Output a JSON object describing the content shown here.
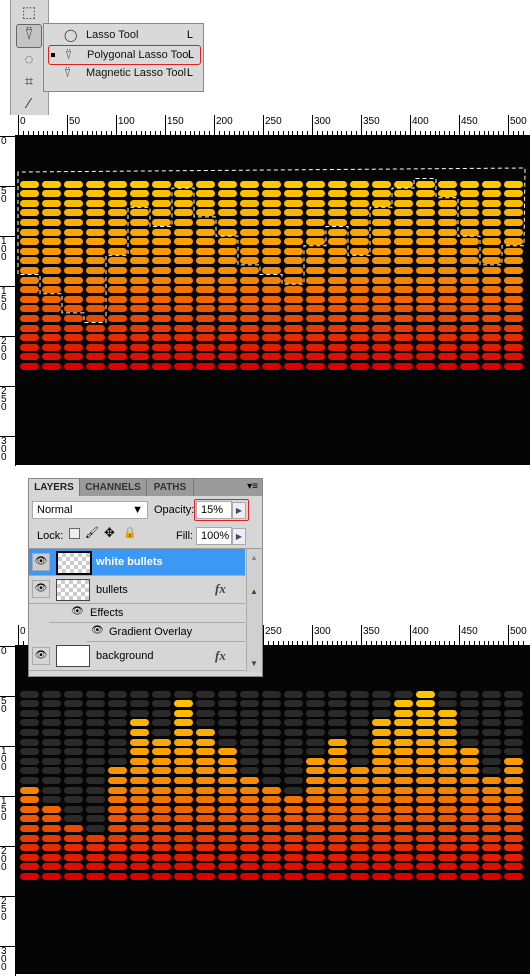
{
  "tools_flyout": {
    "items": [
      {
        "label": "Lasso Tool",
        "shortcut": "L",
        "icon": "lasso-icon"
      },
      {
        "label": "Polygonal Lasso Tool",
        "shortcut": "L",
        "icon": "polygonal-lasso-icon",
        "selected": true
      },
      {
        "label": "Magnetic Lasso Tool",
        "shortcut": "L",
        "icon": "magnetic-lasso-icon"
      }
    ]
  },
  "ruler": {
    "h_labels": [
      "0",
      "50",
      "100",
      "150",
      "200",
      "250",
      "300",
      "350",
      "400",
      "450",
      "500"
    ],
    "v_labels": [
      "0",
      "50",
      "100",
      "150",
      "200",
      "250",
      "300"
    ]
  },
  "meter": {
    "columns": 23,
    "rows": 20,
    "levels": [
      10,
      8,
      6,
      5,
      12,
      17,
      15,
      19,
      16,
      14,
      11,
      10,
      9,
      13,
      15,
      12,
      17,
      19,
      20,
      18,
      14,
      11,
      13
    ],
    "colors": {
      "top": "#ffc800",
      "mid": "#f58a00",
      "bottom": "#dc0000",
      "unlit": "#2a2a2a",
      "background": "#050505"
    }
  },
  "layers_panel": {
    "tabs": [
      "LAYERS",
      "CHANNELS",
      "PATHS"
    ],
    "blend_mode": "Normal",
    "opacity_label": "Opacity:",
    "opacity": "15%",
    "lock_label": "Lock:",
    "fill_label": "Fill:",
    "fill": "100%",
    "layers": [
      {
        "name": "white bullets",
        "selected": true
      },
      {
        "name": "bullets",
        "fx": "fx",
        "effects_label": "Effects",
        "effect": "Gradient Overlay"
      },
      {
        "name": "background",
        "fx": "fx"
      }
    ]
  }
}
